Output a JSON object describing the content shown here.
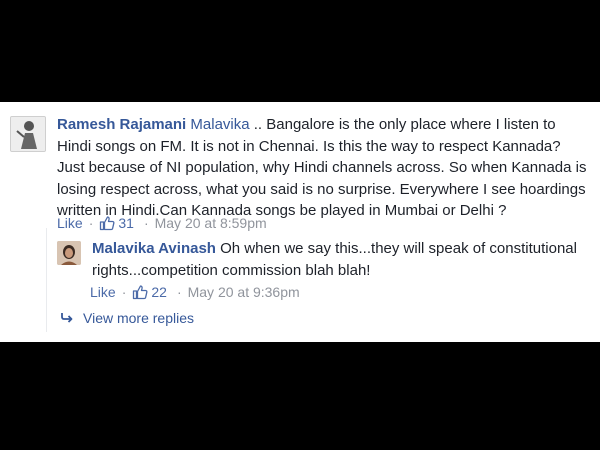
{
  "comment": {
    "author": "Ramesh Rajamani",
    "mention": "Malavika",
    "text": " .. Bangalore is the only place where I listen to Hindi songs on FM. It is not in Chennai. Is this the way to respect Kannada? Just because of NI population, why Hindi channels across. So when Kannada is losing respect across, what you said is no surprise. Everywhere I see hoardings written in Hindi.Can Kannada songs be played in Mumbai or Delhi ?",
    "like_label": "Like",
    "separator": "·",
    "like_count": "31",
    "timestamp": "May 20 at 8:59pm"
  },
  "reply": {
    "author": "Malavika Avinash",
    "text": " Oh when we say this...they will speak of constitutional rights...competition commission blah blah!",
    "like_label": "Like",
    "separator": "·",
    "like_count": "22",
    "timestamp": "May 20 at 9:36pm"
  },
  "view_more": {
    "label": "View more replies",
    "icon": "reply-arrow-icon"
  },
  "colors": {
    "background": "#000000",
    "panel": "#ffffff",
    "link": "#365899",
    "text": "#1d2129",
    "meta": "#90949c"
  }
}
